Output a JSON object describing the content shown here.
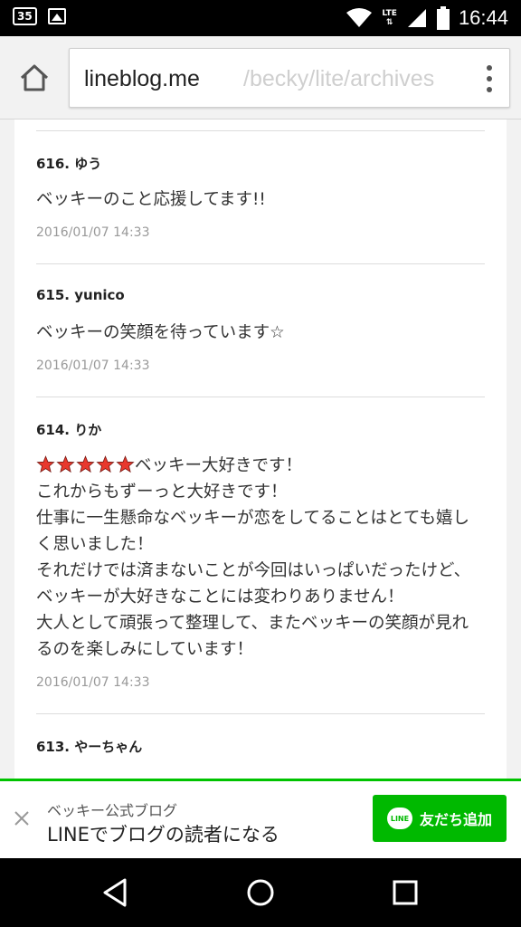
{
  "status_bar": {
    "notification_badge": "35",
    "network": "LTE",
    "time": "16:44",
    "icons": [
      "notification-35-icon",
      "image-icon",
      "wifi-icon",
      "lte-icon",
      "signal-icon",
      "battery-icon"
    ]
  },
  "browser": {
    "url_host": "lineblog.me",
    "url_path": "/becky/lite/archives",
    "icons": [
      "home-icon",
      "overflow-menu-icon"
    ]
  },
  "comments": [
    {
      "number": "616.",
      "author": "ゆう",
      "body": "ベッキーのこと応援してます!!",
      "date": "2016/01/07 14:33"
    },
    {
      "number": "615.",
      "author": "yunico",
      "body": "ベッキーの笑顔を待っています☆",
      "date": "2016/01/07 14:33"
    },
    {
      "number": "614.",
      "author": "りか",
      "stars": 5,
      "body_first": "ベッキー大好きです！",
      "body": "これからもずーっと大好きです！\n仕事に一生懸命なベッキーが恋をしてることはとても嬉しく思いました！\nそれだけでは済まないことが今回はいっぱいだったけど、ベッキーが大好きなことには変わりありません！\n大人として頑張って整理して、またベッキーの笑顔が見れるのを楽しみにしています！",
      "date": "2016/01/07 14:33"
    },
    {
      "number": "613.",
      "author": "やーちゃん"
    }
  ],
  "banner": {
    "title": "ベッキー公式ブログ",
    "subtitle": "LINEでブログの読者になる",
    "button_label": "友だち追加",
    "logo_text": "LINE",
    "accent": "#00b900"
  },
  "nav": {
    "icons": [
      "back-icon",
      "home-circle-icon",
      "recents-icon"
    ]
  }
}
